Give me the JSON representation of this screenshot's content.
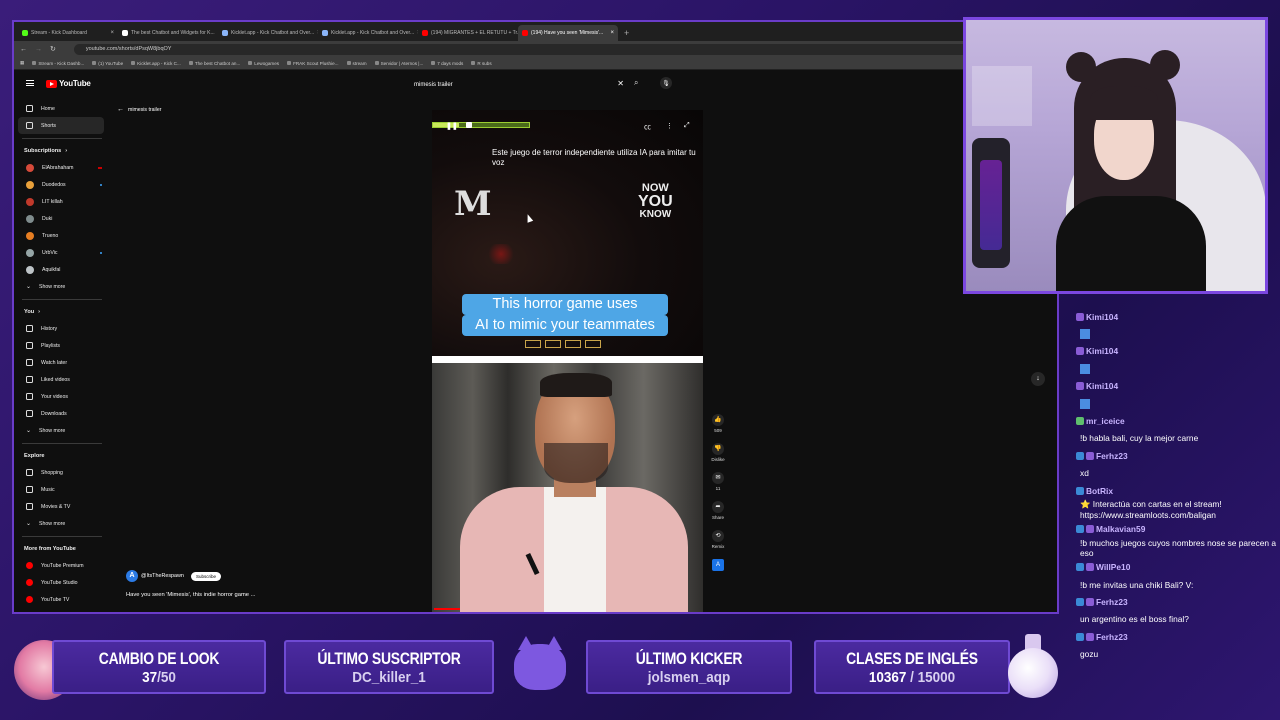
{
  "browser": {
    "tabs": [
      {
        "label": "Stream - Kick Dashboard",
        "color": "#53fc18",
        "active": false
      },
      {
        "label": "The best Chatbot and Widgets for K...",
        "color": "#ffffff",
        "active": false
      },
      {
        "label": "Kicklet.app - Kick Chatbot and Over...",
        "color": "#8ab4f8",
        "active": false
      },
      {
        "label": "Kicklet.app - Kick Chatbot and Over...",
        "color": "#8ab4f8",
        "active": false
      },
      {
        "label": "(194) MIGRANTES + EL RETUTU + Tr...",
        "color": "#ff0000",
        "active": false
      },
      {
        "label": "(194) Have you seen 'Mimesis'...",
        "color": "#ff0000",
        "active": true
      }
    ],
    "url": "youtube.com/shorts/dPsqW8jbqOY",
    "bookmarks": [
      "Stream - Kick Dashb...",
      "(1) YouTube",
      "Kicklet.app - Kick C...",
      "The best Chatbot an...",
      "Lewogames",
      "FRAK Scout Plushie...",
      "stream",
      "Servidor | Aternos |...",
      "7 days mods",
      "R subs"
    ]
  },
  "youtube": {
    "logo": "YouTube",
    "search_value": "mimesis trailer",
    "back_label": "mimesis trailer",
    "nav_top": [
      {
        "label": "Home",
        "icon": "home-icon",
        "active": false
      },
      {
        "label": "Shorts",
        "icon": "shorts-icon",
        "active": true
      }
    ],
    "subscriptions_heading": "Subscriptions",
    "subscriptions": [
      {
        "label": "ElAbrahaham",
        "color": "#d64a3a",
        "indicator": "live"
      },
      {
        "label": "Duodedos",
        "color": "#e9a13b",
        "indicator": "dot"
      },
      {
        "label": "LIT killah",
        "color": "#c0392b",
        "indicator": ""
      },
      {
        "label": "Duki",
        "color": "#7f8c8d",
        "indicator": ""
      },
      {
        "label": "Trueno",
        "color": "#e67e22",
        "indicator": ""
      },
      {
        "label": "UrbVic",
        "color": "#95a5a6",
        "indicator": "dot"
      },
      {
        "label": "Aquikfal",
        "color": "#bdc3c7",
        "indicator": ""
      }
    ],
    "subscriptions_more": "Show more",
    "you_heading": "You",
    "you_items": [
      {
        "label": "History",
        "icon": "history-icon"
      },
      {
        "label": "Playlists",
        "icon": "playlists-icon"
      },
      {
        "label": "Watch later",
        "icon": "watch-later-icon"
      },
      {
        "label": "Liked videos",
        "icon": "liked-videos-icon"
      },
      {
        "label": "Your videos",
        "icon": "your-videos-icon"
      },
      {
        "label": "Downloads",
        "icon": "downloads-icon"
      }
    ],
    "you_more": "Show more",
    "explore_heading": "Explore",
    "explore_items": [
      {
        "label": "Shopping",
        "icon": "shopping-icon"
      },
      {
        "label": "Music",
        "icon": "music-icon"
      },
      {
        "label": "Movies & TV",
        "icon": "movies-icon"
      }
    ],
    "explore_more": "Show more",
    "more_heading": "More from YouTube",
    "more_items": [
      {
        "label": "YouTube Premium",
        "icon": "youtube-premium-icon"
      },
      {
        "label": "YouTube Studio",
        "icon": "youtube-studio-icon"
      },
      {
        "label": "YouTube TV",
        "icon": "youtube-tv-icon"
      }
    ],
    "short": {
      "progress": 0.27,
      "caption_top": "Este juego de terror independiente utiliza IA para imitar tu voz",
      "logo_letter": "M",
      "nyk": [
        "NOW",
        "YOU",
        "KNOW"
      ],
      "subtitle_line1": "This horror game uses",
      "subtitle_line2": "AI to mimic your teammates",
      "channel": "@ItsTheRespawn",
      "subscribe": "Subscribe",
      "description": "Have you seen 'Mimesis', this indie horror game ..."
    },
    "actions": [
      {
        "icon": "like-icon",
        "label": "509"
      },
      {
        "icon": "dislike-icon",
        "label": "Dislike"
      },
      {
        "icon": "comments-icon",
        "label": "11"
      },
      {
        "icon": "share-icon",
        "label": "Share"
      },
      {
        "icon": "remix-icon",
        "label": "Remix"
      }
    ]
  },
  "chat": [
    {
      "user": "Kimi104",
      "badges": [
        "p"
      ],
      "msg": ""
    },
    {
      "user": "Kimi104",
      "badges": [
        "p"
      ],
      "msg": ""
    },
    {
      "user": "Kimi104",
      "badges": [
        "p"
      ],
      "msg": ""
    },
    {
      "user": "mr_iceice",
      "badges": [
        "g"
      ],
      "msg": "!b habla bali, cuy la mejor carne"
    },
    {
      "user": "Ferhz23",
      "badges": [
        "b",
        "p"
      ],
      "msg": "xd"
    },
    {
      "user": "BotRix",
      "badges": [
        "b"
      ],
      "msg": "⭐ Interactúa con cartas en el stream! https://www.streamloots.com/baligan"
    },
    {
      "user": "Malkavian59",
      "badges": [
        "b",
        "p"
      ],
      "msg": "!b muchos juegos cuyos nombres nose se parecen a eso"
    },
    {
      "user": "WillPe10",
      "badges": [
        "b",
        "p"
      ],
      "msg": "!b me invitas una chiki Bali? V:"
    },
    {
      "user": "Ferhz23",
      "badges": [
        "b",
        "p"
      ],
      "msg": "un argentino es el boss final?"
    },
    {
      "user": "Ferhz23",
      "badges": [
        "b",
        "p"
      ],
      "msg": "gozu"
    }
  ],
  "bottom": {
    "look": {
      "title": "CAMBIO DE LOOK",
      "current": "37",
      "goal": "/50"
    },
    "subscriber": {
      "title": "ÚLTIMO SUSCRIPTOR",
      "value": "DC_killer_1"
    },
    "kicker": {
      "title": "ÚLTIMO KICKER",
      "value": "jolsmen_aqp"
    },
    "english": {
      "title": "CLASES DE INGLÉS",
      "current": "10367",
      "goal": " / 15000"
    }
  },
  "colors": {
    "accent": "#6f4ad3",
    "yt_red": "#ff0000",
    "caption_blue": "#4ea6e6"
  }
}
